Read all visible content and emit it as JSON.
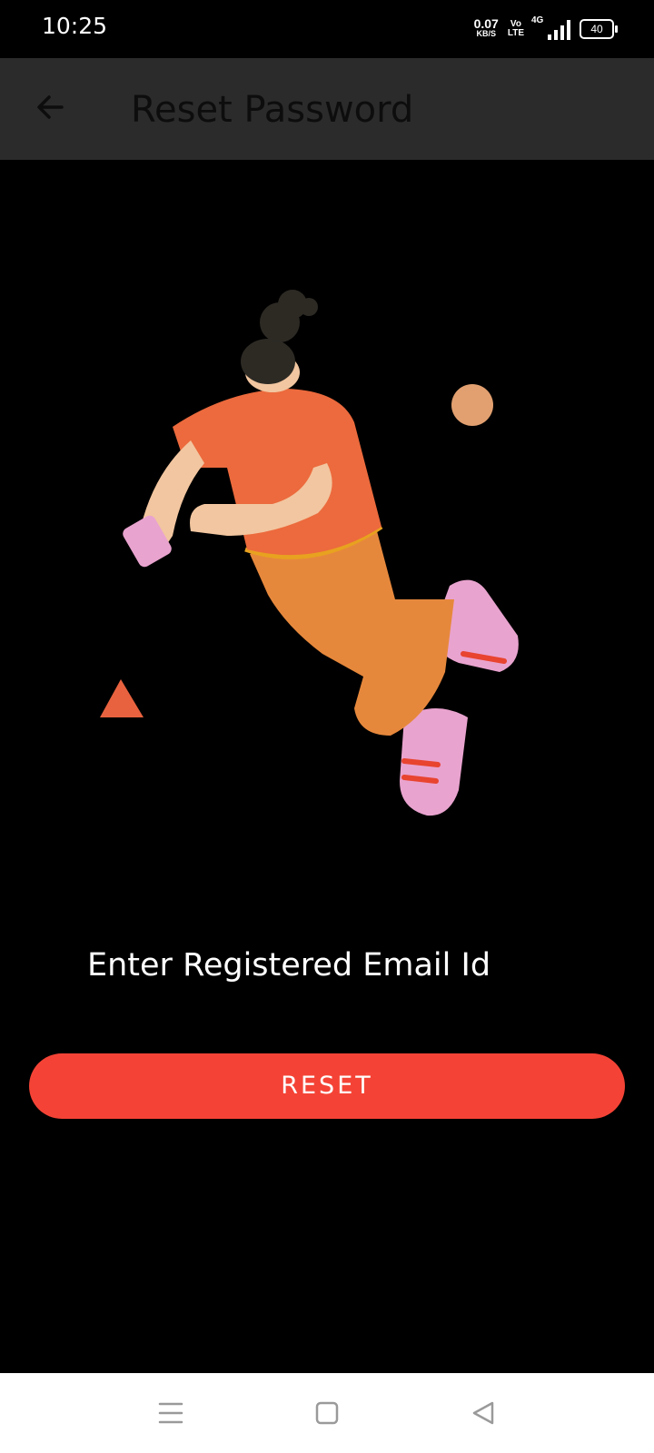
{
  "status_bar": {
    "time": "10:25",
    "net_speed_value": "0.07",
    "net_speed_unit": "KB/S",
    "volte_top": "Vo",
    "volte_bottom": "LTE",
    "network_type": "4G",
    "battery_level": "40"
  },
  "app_bar": {
    "title": "Reset Password",
    "back_icon": "arrow-left-icon"
  },
  "form": {
    "email_label": "Enter Registered Email Id",
    "reset_label": "RESET"
  },
  "nav_bar": {
    "recents_icon": "menu-icon",
    "home_icon": "square-icon",
    "back_icon": "triangle-back-icon"
  },
  "colors": {
    "accent": "#f44336",
    "background": "#000000",
    "app_bar": "#2b2b2b",
    "nav_bar": "#ffffff"
  }
}
